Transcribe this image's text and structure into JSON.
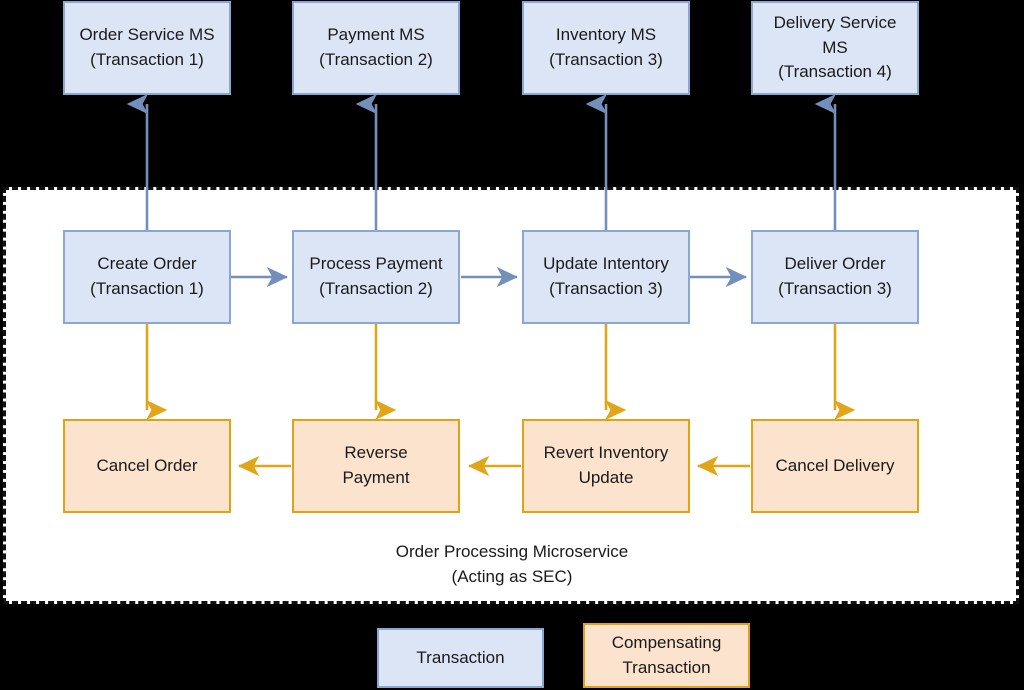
{
  "diagram": {
    "title_caption": "Order Processing Microservice\n(Acting as SEC)",
    "colors": {
      "transaction_fill": "#dbe5f6",
      "transaction_border": "#8aa7d2",
      "compensating_fill": "#fce3cd",
      "compensating_border": "#dfa314",
      "arrow_blue": "#7390bd",
      "arrow_orange": "#e0a617",
      "container_background": "#ffffff",
      "page_background": "#000000",
      "text": "#1a1a1a"
    }
  },
  "microservices": [
    {
      "id": "order-service-ms",
      "label": "Order Service MS\n(Transaction 1)"
    },
    {
      "id": "payment-ms",
      "label": "Payment MS\n(Transaction 2)"
    },
    {
      "id": "inventory-ms",
      "label": "Inventory MS\n(Transaction 3)"
    },
    {
      "id": "delivery-service-ms",
      "label": "Delivery Service\nMS\n(Transaction 4)"
    }
  ],
  "transactions": [
    {
      "id": "create-order",
      "label": "Create Order\n(Transaction 1)"
    },
    {
      "id": "process-payment",
      "label": "Process Payment\n(Transaction 2)"
    },
    {
      "id": "update-inventory",
      "label": "Update Intentory\n(Transaction 3)"
    },
    {
      "id": "deliver-order",
      "label": "Deliver Order\n(Transaction 3)"
    }
  ],
  "compensating_transactions": [
    {
      "id": "cancel-order",
      "label": "Cancel Order"
    },
    {
      "id": "reverse-payment",
      "label": "Reverse\nPayment"
    },
    {
      "id": "revert-inventory-update",
      "label": "Revert Inventory\nUpdate"
    },
    {
      "id": "cancel-delivery",
      "label": "Cancel Delivery"
    }
  ],
  "legend": [
    {
      "id": "legend-transaction",
      "label": "Transaction"
    },
    {
      "id": "legend-compensating-transaction",
      "label": "Compensating\nTransaction"
    }
  ]
}
